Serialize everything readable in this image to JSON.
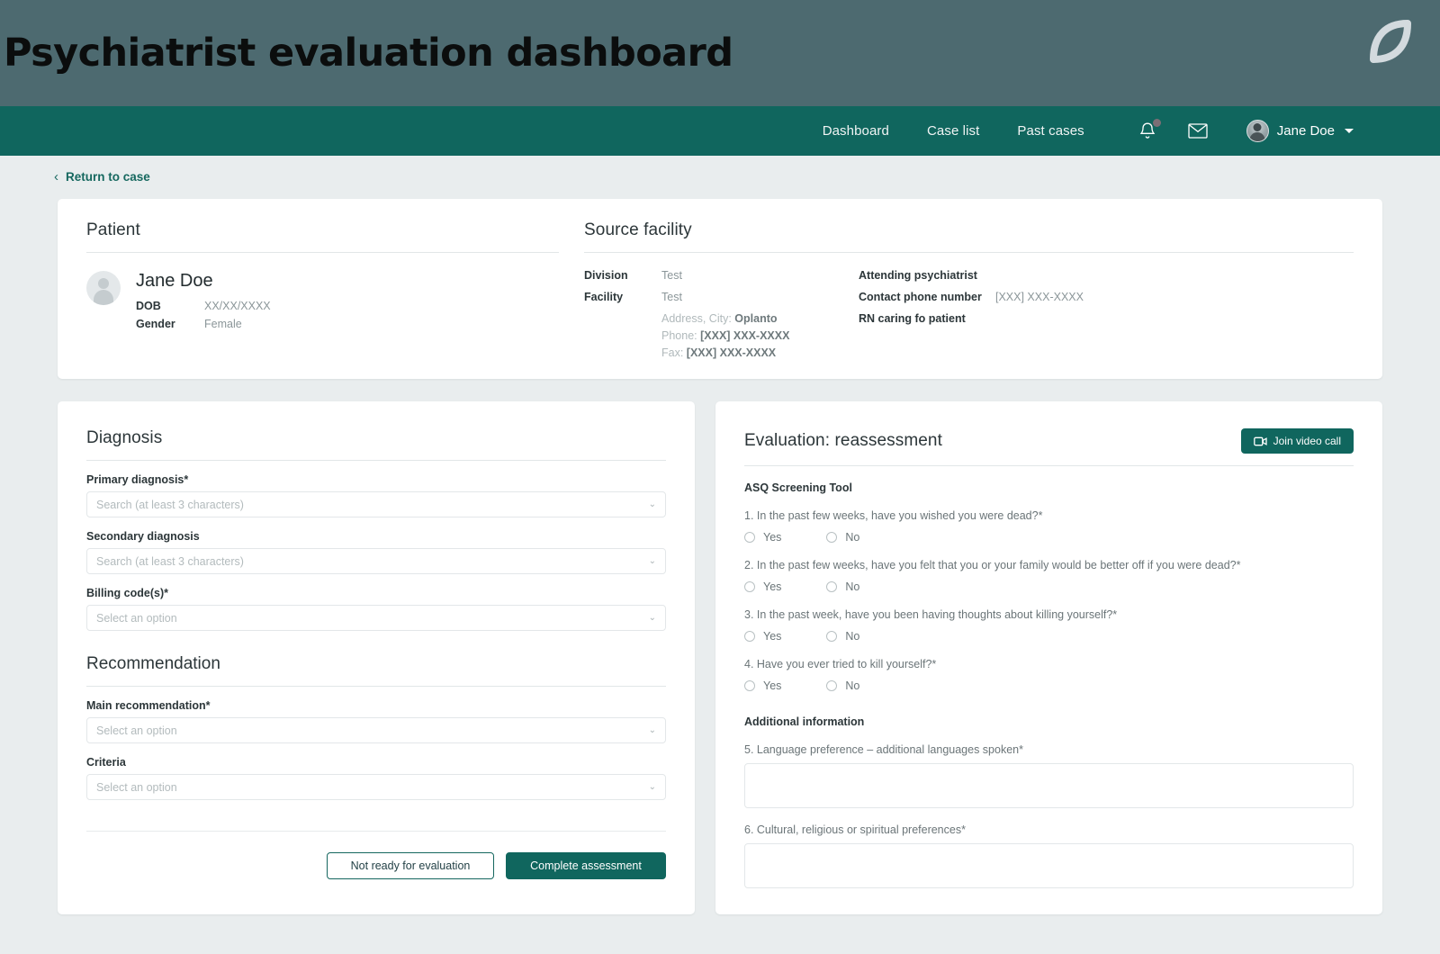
{
  "header": {
    "title": "Psychiatrist evaluation dashboard",
    "logo_icon": "leaf-logo-icon",
    "band_color": "#4d6a70"
  },
  "nav": {
    "accent_color": "#10665e",
    "links": [
      {
        "label": "Dashboard"
      },
      {
        "label": "Case list"
      },
      {
        "label": "Past cases"
      }
    ],
    "icons": [
      {
        "name": "notifications-bell-icon",
        "has_badge": true
      },
      {
        "name": "messages-envelope-icon",
        "has_badge": false
      }
    ],
    "user": {
      "name": "Jane Doe",
      "chevron": "chevron-down-icon"
    }
  },
  "breadcrumb": {
    "back_label": "Return to case",
    "chevron": "‹"
  },
  "patient": {
    "section_title": "Patient",
    "name": "Jane Doe",
    "fields": [
      {
        "key": "DOB",
        "value": "XX/XX/XXXX"
      },
      {
        "key": "Gender",
        "value": "Female"
      }
    ]
  },
  "facility": {
    "section_title": "Source facility",
    "left": [
      {
        "key": "Division",
        "value": "Test"
      },
      {
        "key": "Facility",
        "value": "Test"
      }
    ],
    "address_lines": [
      {
        "label": "Address, City:",
        "value": "Oplanto"
      },
      {
        "label": "Phone:",
        "value": "[XXX] XXX-XXXX"
      },
      {
        "label": "Fax:",
        "value": "[XXX] XXX-XXXX"
      }
    ],
    "right": [
      {
        "key": "Attending psychiatrist",
        "value": ""
      },
      {
        "key": "Contact phone number",
        "value": "[XXX] XXX-XXXX"
      },
      {
        "key": "RN caring fo patient",
        "value": ""
      }
    ]
  },
  "diagnosis": {
    "section_title": "Diagnosis",
    "fields": [
      {
        "label": "Primary diagnosis*",
        "placeholder": "Search (at least 3 characters)",
        "value": ""
      },
      {
        "label": "Secondary diagnosis",
        "placeholder": "Search (at least 3 characters)",
        "value": ""
      },
      {
        "label": "Billing code(s)*",
        "placeholder": "Select an option",
        "value": ""
      }
    ]
  },
  "recommendation": {
    "section_title": "Recommendation",
    "fields": [
      {
        "label": "Main recommendation*",
        "placeholder": "Select an option",
        "value": ""
      },
      {
        "label": "Criteria",
        "placeholder": "Select an option",
        "value": ""
      }
    ]
  },
  "actions": {
    "secondary_label": "Not ready for evaluation",
    "primary_label": "Complete assessment"
  },
  "evaluation": {
    "section_title": "Evaluation: reassessment",
    "video_button": {
      "label": "Join video call",
      "icon": "video-camera-icon"
    },
    "asq_group_title": "ASQ Screening Tool",
    "questions": [
      {
        "text": "1. In the past few weeks, have you wished you were dead?*",
        "options": [
          "Yes",
          "No"
        ]
      },
      {
        "text": "2. In the past few weeks, have you felt that you or your family would be better off if you were dead?*",
        "options": [
          "Yes",
          "No"
        ]
      },
      {
        "text": "3. In the past week, have you been having thoughts about killing yourself?*",
        "options": [
          "Yes",
          "No"
        ]
      },
      {
        "text": "4. Have you ever tried to kill yourself?*",
        "options": [
          "Yes",
          "No"
        ]
      }
    ],
    "additional_group_title": "Additional information",
    "text_questions": [
      {
        "text": "5. Language preference – additional languages spoken*",
        "value": ""
      },
      {
        "text": "6. Cultural, religious or spiritual preferences*",
        "value": ""
      }
    ]
  }
}
